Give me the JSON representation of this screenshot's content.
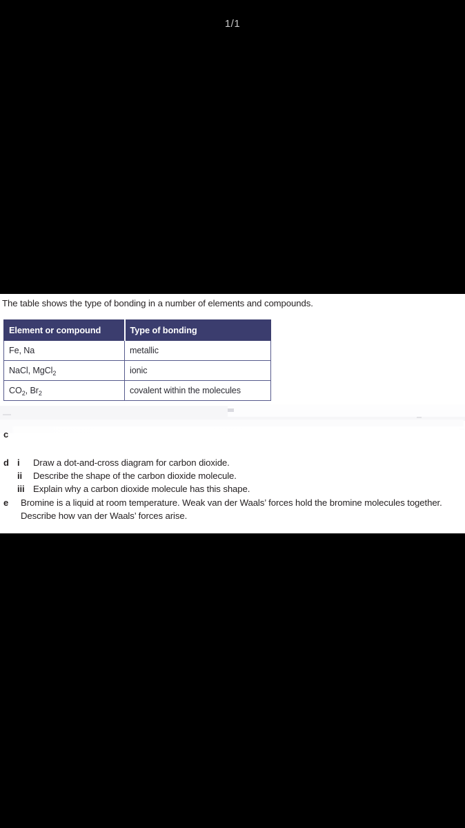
{
  "viewer": {
    "page_counter": "1/1",
    "background_color": "#000000",
    "counter_color": "#c9c9c9"
  },
  "document": {
    "background_color": "#ffffff",
    "text_color": "#231f20",
    "intro": "The table shows the type of bonding in a number of elements and compounds.",
    "table": {
      "header_background": "#3b3d6e",
      "header_text_color": "#ffffff",
      "border_color": "#565a8c",
      "columns": [
        "Element or compound",
        "Type of bonding"
      ],
      "rows": [
        {
          "compound": "Fe, Na",
          "compound_sub": "",
          "bonding": "metallic"
        },
        {
          "compound": "NaCl, MgCl",
          "compound_sub": "2",
          "bonding": "ionic"
        },
        {
          "compound": "CO",
          "compound_sub": "2",
          "compound_b": ", Br",
          "compound_sub_b": "2",
          "bonding": "covalent within the molecules"
        }
      ]
    },
    "questions": [
      {
        "letter": "c",
        "state": "erased",
        "text": ""
      },
      {
        "letter": "d",
        "state": "visible",
        "subitems": [
          {
            "roman": "i",
            "text": "Draw a dot-and-cross diagram for carbon dioxide."
          },
          {
            "roman": "ii",
            "text": "Describe the shape of the carbon dioxide molecule."
          },
          {
            "roman": "iii",
            "text": "Explain why a carbon dioxide molecule has this shape."
          }
        ]
      },
      {
        "letter": "e",
        "state": "visible",
        "text": "Bromine is a liquid at room temperature. Weak van der Waals’ forces hold the bromine molecules together. Describe how van der Waals’ forces arise."
      }
    ]
  }
}
